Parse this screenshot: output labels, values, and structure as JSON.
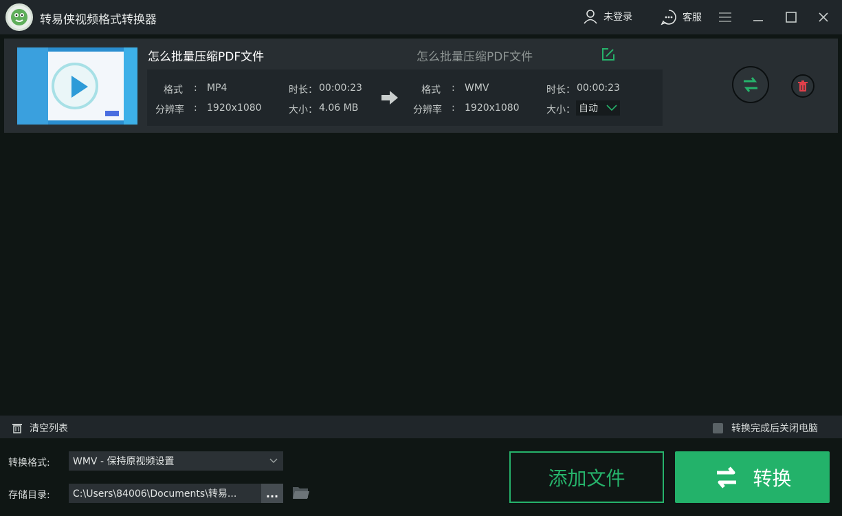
{
  "app": {
    "title": "转易侠视频格式转换器"
  },
  "titlebar": {
    "login_label": "未登录",
    "service_label": "客服",
    "icons": [
      "user-icon",
      "chat-icon",
      "menu-icon",
      "minimize-icon",
      "maximize-icon",
      "close-icon"
    ]
  },
  "file": {
    "source_name": "怎么批量压缩PDF文件",
    "output_name": "怎么批量压缩PDF文件",
    "source": {
      "format_label": "格式",
      "format": "MP4",
      "resolution_label": "分辨率",
      "resolution": "1920x1080",
      "duration_label": "时长",
      "duration": "00:00:23",
      "size_label": "大小",
      "size": "4.06 MB"
    },
    "target": {
      "format_label": "格式",
      "format": "WMV",
      "resolution_label": "分辨率",
      "resolution": "1920x1080",
      "duration_label": "时长",
      "duration": "00:00:23",
      "size_label": "大小",
      "size_option": "自动"
    },
    "colon": ":",
    "colon_full": "："
  },
  "list_bar": {
    "clear_label": "清空列表",
    "shutdown_label": "转换完成后关闭电脑",
    "shutdown_checked": false
  },
  "bottom": {
    "format_label": "转换格式:",
    "format_value": "WMV - 保持原视频设置",
    "path_label": "存储目录:",
    "path_value": "C:\\Users\\84006\\Documents\\转易...",
    "browse_label": "...",
    "add_files_label": "添加文件",
    "convert_label": "转换"
  },
  "colors": {
    "accent_green": "#23b26a",
    "delete_red": "#e0404a",
    "background": "#0f1614",
    "panel": "#20262a"
  }
}
